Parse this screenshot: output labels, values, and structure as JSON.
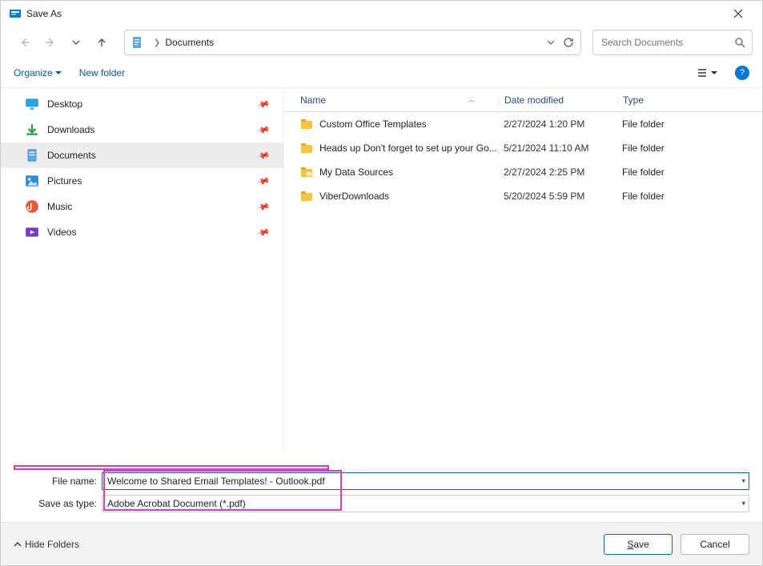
{
  "window": {
    "title": "Save As"
  },
  "nav": {
    "path_current": "Documents",
    "search_placeholder": "Search Documents"
  },
  "toolbar": {
    "organize": "Organize",
    "new_folder": "New folder"
  },
  "sidebar": {
    "items": [
      {
        "label": "Desktop"
      },
      {
        "label": "Downloads"
      },
      {
        "label": "Documents"
      },
      {
        "label": "Pictures"
      },
      {
        "label": "Music"
      },
      {
        "label": "Videos"
      }
    ]
  },
  "columns": {
    "name": "Name",
    "date": "Date modified",
    "type": "Type"
  },
  "files": [
    {
      "name": "Custom Office Templates",
      "date": "2/27/2024 1:20 PM",
      "type": "File folder",
      "icon": "folder"
    },
    {
      "name": "Heads up Don't forget to set up your Go...",
      "date": "5/21/2024 11:10 AM",
      "type": "File folder",
      "icon": "folder"
    },
    {
      "name": "My Data Sources",
      "date": "2/27/2024 2:25 PM",
      "type": "File folder",
      "icon": "datasource"
    },
    {
      "name": "ViberDownloads",
      "date": "5/20/2024 5:59 PM",
      "type": "File folder",
      "icon": "folder"
    }
  ],
  "form": {
    "filename_label": "File name:",
    "filename_value": "Welcome to Shared Email Templates! - Outlook.pdf",
    "type_label": "Save as type:",
    "type_value": "Adobe Acrobat Document (*.pdf)"
  },
  "footer": {
    "hide_folders": "Hide Folders",
    "save": "Save",
    "cancel": "Cancel"
  }
}
